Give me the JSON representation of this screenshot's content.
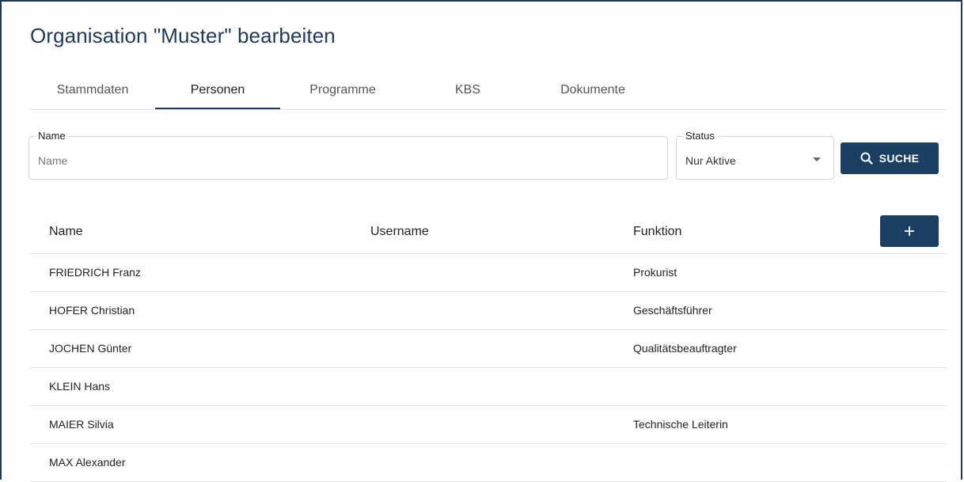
{
  "page": {
    "title": "Organisation \"Muster\" bearbeiten"
  },
  "tabs": [
    {
      "label": "Stammdaten"
    },
    {
      "label": "Personen"
    },
    {
      "label": "Programme"
    },
    {
      "label": "KBS"
    },
    {
      "label": "Dokumente"
    }
  ],
  "active_tab": "Personen",
  "filters": {
    "name": {
      "legend": "Name",
      "placeholder": "Name",
      "value": ""
    },
    "status": {
      "legend": "Status",
      "value": "Nur Aktive"
    },
    "search_button": {
      "label": "SUCHE",
      "icon": "search-icon"
    }
  },
  "table": {
    "columns": [
      "Name",
      "Username",
      "Funktion"
    ],
    "add_button": {
      "icon": "plus-icon",
      "label": "+"
    },
    "rows": [
      {
        "name": "FRIEDRICH Franz",
        "username": "",
        "funktion": "Prokurist"
      },
      {
        "name": "HOFER Christian",
        "username": "",
        "funktion": "Geschäftsführer"
      },
      {
        "name": "JOCHEN Günter",
        "username": "",
        "funktion": "Qualitätsbeauftragter"
      },
      {
        "name": "KLEIN Hans",
        "username": "",
        "funktion": ""
      },
      {
        "name": "MAIER Silvia",
        "username": "",
        "funktion": "Technische Leiterin"
      },
      {
        "name": "MAX Alexander",
        "username": "",
        "funktion": ""
      }
    ]
  },
  "colors": {
    "primary": "#1b3e63",
    "title": "#1d3a5c",
    "divider": "#e2e2e2"
  }
}
